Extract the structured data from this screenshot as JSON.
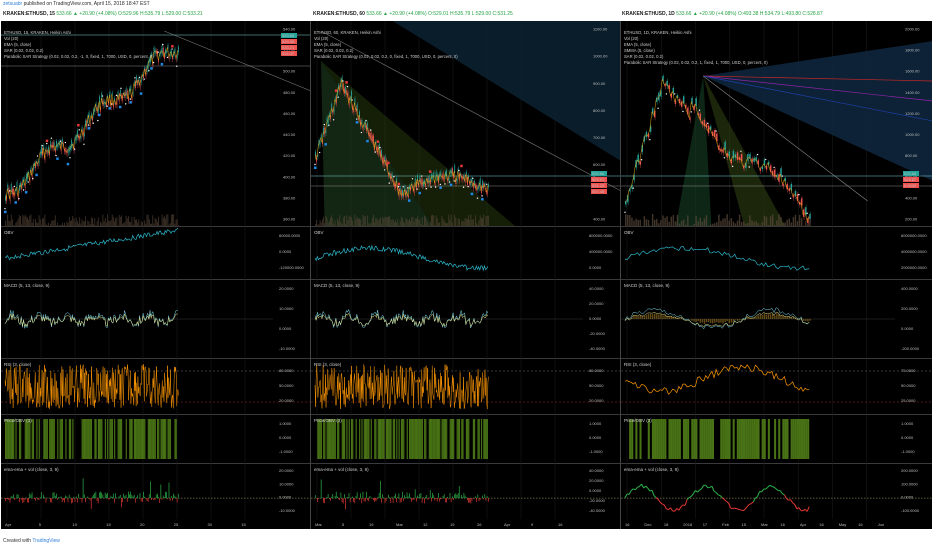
{
  "header": {
    "author": "zetsuabr",
    "published_text": "published on TradingView.com, April 15, 2018 18:47 EST"
  },
  "panels": [
    {
      "symbol": "KRAKEN:ETHUSD, 15",
      "quote": "533.66 ▲ +20.90 (+4.08%) O:529.96 H:535.79 L:529.00 C:533.21",
      "legend": [
        "ETHUSD, 15, KRAKEN, Heikin Ashi",
        "Vol (20)",
        "EMA (5, close)",
        "SAR (0.02, 0.02, 0.2)",
        "Parabolic SAR Strategy (0.02, 0.02, 0.2, -1, 0, fixed, 1, 7000, USD, 0, percent, 0)"
      ],
      "price_ticks": [
        "540.00",
        "520.00",
        "500.00",
        "480.00",
        "460.00",
        "440.00",
        "420.00",
        "400.00",
        "380.00",
        "360.00"
      ],
      "obv_label": "OBV",
      "obv_ticks": [
        "60000.0000",
        "0.0000",
        "-120000.0000"
      ],
      "macd_label": "MACD (5, 13, close, 9)",
      "macd_ticks": [
        "20.0000",
        "10.0000",
        "0.0000",
        "-10.0000"
      ],
      "rsi_label": "RSI (3, close)",
      "rsi_ticks": [
        "80.0000",
        "50.0000",
        "20.0000"
      ],
      "pobv_label": "Price/OBV (3)",
      "pobv_ticks": [
        "1.0000",
        "0.0000",
        "-1.0000"
      ],
      "ema_label": "ema-ema + vol (close, 3, 9)",
      "ema_ticks": [
        "20.0000",
        "10.0000",
        "0.0000",
        "-10.0000"
      ],
      "xticks": [
        "Apr",
        "5",
        "10",
        "15",
        "20",
        "25",
        "30",
        "15"
      ],
      "badges": [
        "533.66",
        "529.96",
        "533.21",
        "516.37"
      ]
    },
    {
      "symbol": "KRAKEN:ETHUSD, 60",
      "quote": "533.66 ▲ +20.90 (+4.08%) O:529.01 H:535.79 L:529.00 C:531.25",
      "legend": [
        "ETHUSD, 60, KRAKEN, Heikin Ashi",
        "Vol (20)",
        "EMA (5, close)",
        "SAR (0.02, 0.02, 0.2)",
        "Parabolic SAR Strategy (0.02, 0.02, 0.2, 0, fixed, 1, 7000, USD, 0, percent, 0)"
      ],
      "price_ticks": [
        "1100.00",
        "1000.00",
        "900.00",
        "800.00",
        "700.00",
        "600.00",
        "500.00",
        "400.00"
      ],
      "obv_label": "OBV",
      "obv_ticks": [
        "800000.0000",
        "400000.0000",
        "0.0000"
      ],
      "macd_label": "MACD (5, 13, close, 9)",
      "macd_ticks": [
        "40.0000",
        "20.0000",
        "0.0000",
        "-20.0000",
        "-40.0000"
      ],
      "rsi_label": "RSI (3, close)",
      "rsi_ticks": [
        "80.0000",
        "50.0000",
        "20.0000"
      ],
      "pobv_label": "Price/OBV (3)",
      "pobv_ticks": [
        "1.0000",
        "0.0000",
        "-1.0000"
      ],
      "ema_label": "ema-ema + vol (close, 3, 9)",
      "ema_ticks": [
        "40.0000",
        "20.0000",
        "0.0000",
        "-20.0000",
        "-40.0000"
      ],
      "xticks": [
        "Mar",
        "5",
        "19",
        "Mar",
        "12",
        "19",
        "26",
        "Apr",
        "9",
        "16"
      ],
      "badges": [
        "533.66",
        "529.01",
        "531.25",
        "507.45"
      ]
    },
    {
      "symbol": "KRAKEN:ETHUSD, 1D",
      "quote": "533.66 ▲ +20.90 (+4.08%) O:493.38 H:534.79 L:493.80 C:528.87",
      "legend": [
        "ETHUSD, 1D, KRAKEN, Heikin Ashi",
        "Vol (20)",
        "EMA (5, close)",
        "SMMA (5, close)",
        "SAR (0.02, 0.02, 0.2)",
        "Parabolic SAR Strategy (0.02, 0.02, 0.2, 1, fixed, 1, 7000, USD, 0, percent, 0)"
      ],
      "price_ticks": [
        "2000.00",
        "1800.00",
        "1600.00",
        "1400.00",
        "1200.00",
        "1000.00",
        "800.00",
        "600.00",
        "400.00",
        "200.00"
      ],
      "obv_label": "OBV",
      "obv_ticks": [
        "6000000.0000",
        "4000000.0000",
        "2000000.0000"
      ],
      "macd_label": "MACD (5, 13, close, 9)",
      "macd_ticks": [
        "400.0000",
        "200.0000",
        "0.0000",
        "-200.0000"
      ],
      "rsi_label": "RSI (3, close)",
      "rsi_ticks": [
        "75.0000",
        "50.0000",
        "25.0000"
      ],
      "pobv_label": "Price/OBV (3)",
      "pobv_ticks": [
        "1.0000",
        "0.0000",
        "-1.0000"
      ],
      "ema_label": "ema-ema + vol (close, 3, 9)",
      "ema_ticks": [
        "200.0000",
        "100.0000",
        "0.0000",
        "-100.0000"
      ],
      "xticks": [
        "16",
        "Dec",
        "18",
        "2018",
        "17",
        "Feb",
        "15",
        "Mar",
        "16",
        "Apr",
        "16",
        "May",
        "16",
        "Jun"
      ],
      "badges": [
        "533.66",
        "528.87",
        "0.0000"
      ]
    }
  ],
  "footer": {
    "created_with": "Created with",
    "brand": "TradingView"
  },
  "colors": {
    "up": "#26a69a",
    "down": "#ef5350",
    "obv": "#2bb6c9",
    "macd": "#7fe0f0",
    "signal": "#e8e38a",
    "rsi": "#ff9800",
    "pobv_green": "#5a8f1a",
    "ema_up": "#2cb34a",
    "ema_down": "#e53935"
  }
}
